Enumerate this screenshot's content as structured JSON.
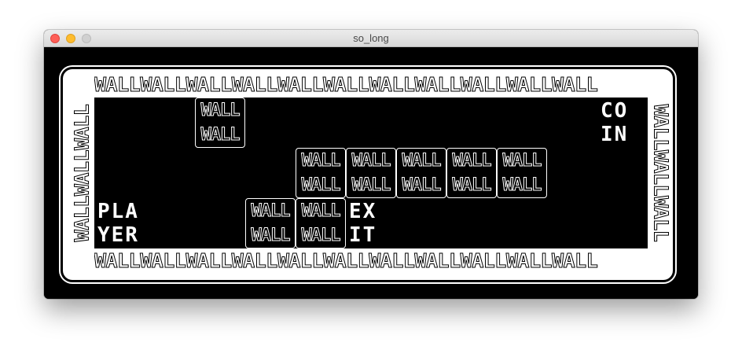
{
  "window": {
    "title": "so_long"
  },
  "border": {
    "label": "WALLWALLWALLWALLWALLWALLWALLWALLWALLWALLWALL"
  },
  "border_side": {
    "label": "WALLWALLWALL"
  },
  "wall_label": "WALL",
  "player": {
    "line1": "PLA",
    "line2": "YER"
  },
  "exit": {
    "line1": "EX",
    "line2": "IT"
  },
  "coin": {
    "line1": "CO",
    "line2": "IN"
  },
  "map": {
    "rows": 3,
    "cols": 11,
    "walls": [
      {
        "row": 0,
        "col": 2
      },
      {
        "row": 1,
        "col": 4
      },
      {
        "row": 1,
        "col": 5
      },
      {
        "row": 1,
        "col": 6
      },
      {
        "row": 1,
        "col": 7
      },
      {
        "row": 1,
        "col": 8
      },
      {
        "row": 2,
        "col": 3
      },
      {
        "row": 2,
        "col": 4
      }
    ],
    "player": {
      "row": 2,
      "col": 0
    },
    "exit": {
      "row": 2,
      "col": 5
    },
    "coin": {
      "row": 0,
      "col": 10
    }
  }
}
